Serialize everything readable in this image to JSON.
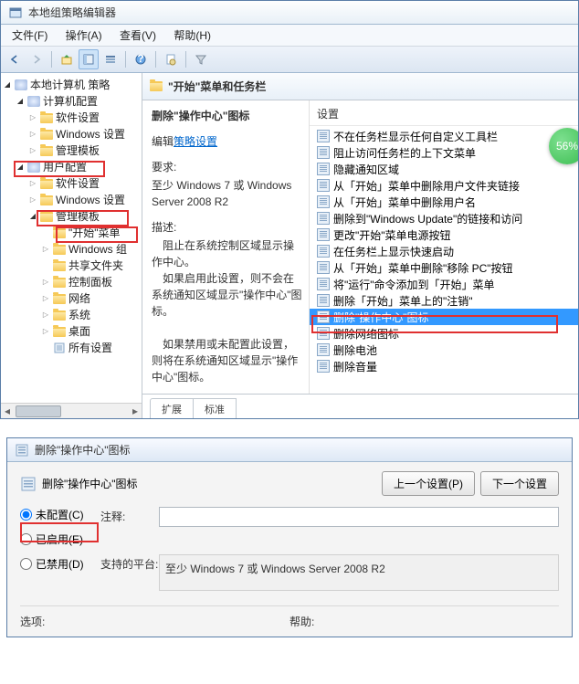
{
  "window1": {
    "title": "本地组策略编辑器",
    "menus": [
      "文件(F)",
      "操作(A)",
      "查看(V)",
      "帮助(H)"
    ],
    "tree": {
      "root": "本地计算机 策略",
      "items": [
        {
          "level": 0,
          "toggle": "▾",
          "icon": "disc",
          "label": "本地计算机 策略"
        },
        {
          "level": 1,
          "toggle": "▾",
          "icon": "disc",
          "label": "计算机配置"
        },
        {
          "level": 2,
          "toggle": "▸",
          "icon": "folder",
          "label": "软件设置"
        },
        {
          "level": 2,
          "toggle": "▸",
          "icon": "folder",
          "label": "Windows 设置"
        },
        {
          "level": 2,
          "toggle": "▸",
          "icon": "folder",
          "label": "管理模板"
        },
        {
          "level": 1,
          "toggle": "▾",
          "icon": "disc",
          "label": "用户配置"
        },
        {
          "level": 2,
          "toggle": "▸",
          "icon": "folder",
          "label": "软件设置"
        },
        {
          "level": 2,
          "toggle": "▸",
          "icon": "folder",
          "label": "Windows 设置"
        },
        {
          "level": 2,
          "toggle": "▾",
          "icon": "folder",
          "label": "管理模板"
        },
        {
          "level": 3,
          "toggle": "",
          "icon": "folder",
          "label": "\"开始\"菜单"
        },
        {
          "level": 3,
          "toggle": "▸",
          "icon": "folder",
          "label": "Windows 组"
        },
        {
          "level": 3,
          "toggle": "",
          "icon": "folder",
          "label": "共享文件夹"
        },
        {
          "level": 3,
          "toggle": "▸",
          "icon": "folder",
          "label": "控制面板"
        },
        {
          "level": 3,
          "toggle": "▸",
          "icon": "folder",
          "label": "网络"
        },
        {
          "level": 3,
          "toggle": "▸",
          "icon": "folder",
          "label": "系统"
        },
        {
          "level": 3,
          "toggle": "▸",
          "icon": "folder",
          "label": "桌面"
        },
        {
          "level": 3,
          "toggle": "",
          "icon": "settings",
          "label": "所有设置"
        }
      ]
    },
    "rightHeader": "\"开始\"菜单和任务栏",
    "detail": {
      "settingTitle": "删除\"操作中心\"图标",
      "editPrefix": "编辑",
      "editLink": "策略设置",
      "reqLabel": "要求:",
      "reqText": "至少 Windows 7 或 Windows Server 2008 R2",
      "descLabel": "描述:",
      "descText": "　阻止在系统控制区域显示操作中心。\n　如果启用此设置，则不会在系统通知区域显示\"操作中心\"图标。\n\n　如果禁用或未配置此设置，则将在系统通知区域显示\"操作中心\"图标。"
    },
    "settingsHeader": "设置",
    "settings": [
      "不在任务栏显示任何自定义工具栏",
      "阻止访问任务栏的上下文菜单",
      "隐藏通知区域",
      "从「开始」菜单中删除用户文件夹链接",
      "从「开始」菜单中删除用户名",
      "删除到\"Windows Update\"的链接和访问",
      "更改\"开始\"菜单电源按钮",
      "在任务栏上显示快速启动",
      "从「开始」菜单中删除\"移除 PC\"按钮",
      "将\"运行\"命令添加到「开始」菜单",
      "删除「开始」菜单上的\"注销\"",
      "删除\"操作中心\"图标",
      "删除网络图标",
      "删除电池",
      "删除音量"
    ],
    "selectedIndex": 11,
    "tabs": [
      "扩展",
      "标准"
    ],
    "badge": "56%"
  },
  "window2": {
    "title": "删除\"操作中心\"图标",
    "navTitle": "删除\"操作中心\"图标",
    "prevBtn": "上一个设置(P)",
    "nextBtn": "下一个设置",
    "radios": {
      "notConfigured": "未配置(C)",
      "enabled": "已启用(E)",
      "disabled": "已禁用(D)"
    },
    "commentLabel": "注释:",
    "commentValue": "",
    "platformLabel": "支持的平台:",
    "platformText": "至少 Windows 7 或 Windows Server 2008 R2",
    "optionsLabel": "选项:",
    "helpLabel": "帮助:"
  }
}
